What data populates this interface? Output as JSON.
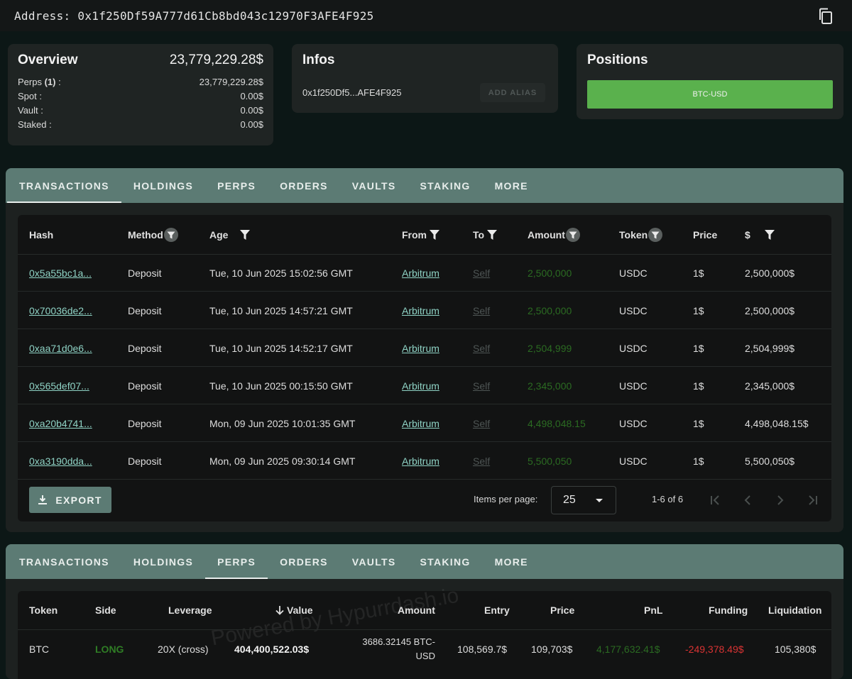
{
  "header": {
    "address_label": "Address: 0x1f250Df59A777d61Cb8bd043c12970F3AFE4F925",
    "copy_icon": "copy-icon"
  },
  "overview": {
    "title": "Overview",
    "total": "23,779,229.28$",
    "rows": [
      {
        "label_pre": "Perps ",
        "label_bold": "(1)",
        "label_post": " :",
        "value": "23,779,229.28$"
      },
      {
        "label_pre": "Spot :",
        "label_bold": "",
        "label_post": "",
        "value": "0.00$"
      },
      {
        "label_pre": "Vault :",
        "label_bold": "",
        "label_post": "",
        "value": "0.00$"
      },
      {
        "label_pre": "Staked :",
        "label_bold": "",
        "label_post": "",
        "value": "0.00$"
      }
    ]
  },
  "infos": {
    "title": "Infos",
    "short_address": "0x1f250Df5...AFE4F925",
    "alias_button": "ADD ALIAS"
  },
  "positions": {
    "title": "Positions",
    "button": "BTC-USD",
    "button_color": "#5ab14d"
  },
  "tabs": [
    "TRANSACTIONS",
    "HOLDINGS",
    "PERPS",
    "ORDERS",
    "VAULTS",
    "STAKING",
    "MORE"
  ],
  "transactions": {
    "active_tab": "TRANSACTIONS",
    "columns": [
      "Hash",
      "Method",
      "Age",
      "From",
      "To",
      "Amount",
      "Token",
      "Price",
      "$"
    ],
    "rows": [
      {
        "hash": "0x5a55bc1a...",
        "method": "Deposit",
        "age": "Tue, 10 Jun 2025 15:02:56 GMT",
        "from": "Arbitrum",
        "to": "Self",
        "amount": "2,500,000",
        "token": "USDC",
        "price": "1$",
        "usd": "2,500,000$"
      },
      {
        "hash": "0x70036de2...",
        "method": "Deposit",
        "age": "Tue, 10 Jun 2025 14:57:21 GMT",
        "from": "Arbitrum",
        "to": "Self",
        "amount": "2,500,000",
        "token": "USDC",
        "price": "1$",
        "usd": "2,500,000$"
      },
      {
        "hash": "0xaa71d0e6...",
        "method": "Deposit",
        "age": "Tue, 10 Jun 2025 14:52:17 GMT",
        "from": "Arbitrum",
        "to": "Self",
        "amount": "2,504,999",
        "token": "USDC",
        "price": "1$",
        "usd": "2,504,999$"
      },
      {
        "hash": "0x565def07...",
        "method": "Deposit",
        "age": "Tue, 10 Jun 2025 00:15:50 GMT",
        "from": "Arbitrum",
        "to": "Self",
        "amount": "2,345,000",
        "token": "USDC",
        "price": "1$",
        "usd": "2,345,000$"
      },
      {
        "hash": "0xa20b4741...",
        "method": "Deposit",
        "age": "Mon, 09 Jun 2025 10:01:35 GMT",
        "from": "Arbitrum",
        "to": "Self",
        "amount": "4,498,048.15",
        "token": "USDC",
        "price": "1$",
        "usd": "4,498,048.15$"
      },
      {
        "hash": "0xa3190dda...",
        "method": "Deposit",
        "age": "Mon, 09 Jun 2025 09:30:14 GMT",
        "from": "Arbitrum",
        "to": "Self",
        "amount": "5,500,050",
        "token": "USDC",
        "price": "1$",
        "usd": "5,500,050$"
      }
    ],
    "export_label": "EXPORT",
    "items_per_page_label": "Items per page:",
    "items_per_page": "25",
    "range": "1-6 of 6"
  },
  "perps": {
    "active_tab": "PERPS",
    "columns": [
      "Token",
      "Side",
      "Leverage",
      "Value",
      "Amount",
      "Entry",
      "Price",
      "PnL",
      "Funding",
      "Liquidation"
    ],
    "rows": [
      {
        "token": "BTC",
        "side": "LONG",
        "leverage": "20X (cross)",
        "value": "404,400,522.03$",
        "amount_line1": "3686.32145 BTC-",
        "amount_line2": "USD",
        "entry": "108,569.7$",
        "price": "109,703$",
        "pnl": "4,177,632.41$",
        "funding": "-249,378.49$",
        "liquidation": "105,380$"
      }
    ],
    "watermark": "Powered by Hypurrdash.io"
  },
  "colors": {
    "accent": "#5c7b74",
    "positive": "#2b6b22",
    "negative": "#d93333",
    "link": "#8fd3c5"
  }
}
